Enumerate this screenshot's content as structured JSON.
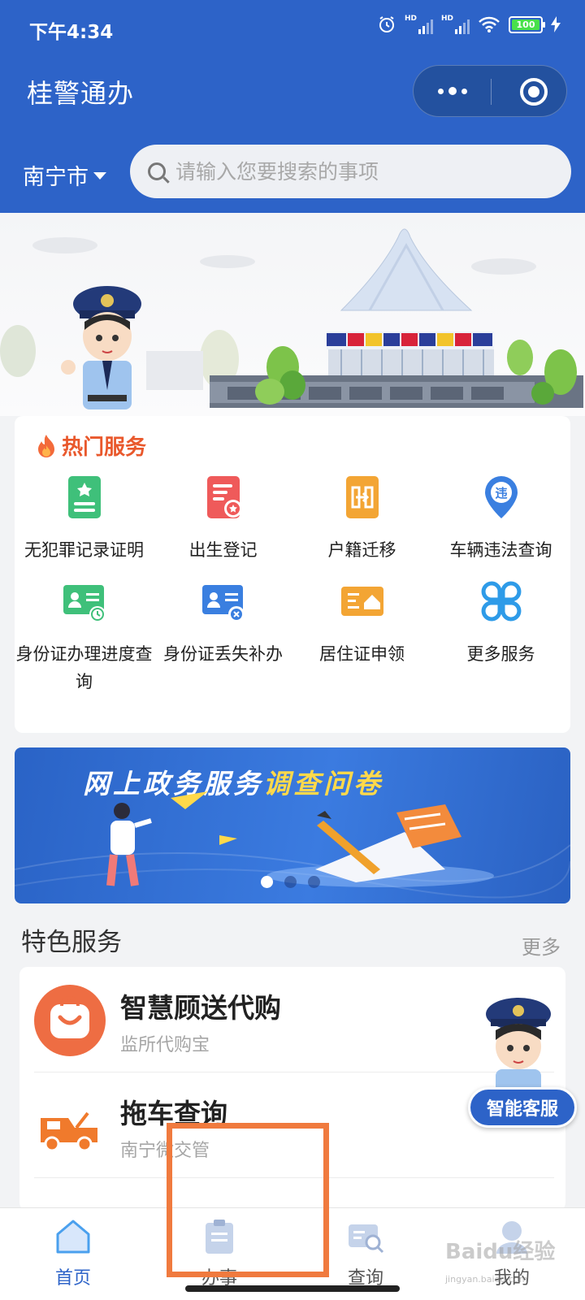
{
  "status_bar": {
    "time": "下午4:34",
    "hd1": "HD",
    "hd2": "HD",
    "battery": "100"
  },
  "header": {
    "title": "桂警通办",
    "city": "南宁市",
    "search_placeholder": "请输入您要搜索的事项"
  },
  "hot_services": {
    "title": "热门服务",
    "items": [
      {
        "label": "无犯罪记录证明",
        "icon": "certificate-icon",
        "color": "#3fc07a"
      },
      {
        "label": "出生登记",
        "icon": "birth-register-icon",
        "color": "#ef5a5a"
      },
      {
        "label": "户籍迁移",
        "icon": "household-transfer-icon",
        "color": "#f3a534"
      },
      {
        "label": "车辆违法查询",
        "icon": "vehicle-violation-icon",
        "color": "#3a7fe0"
      },
      {
        "label": "身份证办理进度查询",
        "icon": "id-progress-icon",
        "color": "#3fc07a"
      },
      {
        "label": "身份证丢失补办",
        "icon": "id-reissue-icon",
        "color": "#3a7fe0"
      },
      {
        "label": "居住证申领",
        "icon": "residence-permit-icon",
        "color": "#f3a534"
      },
      {
        "label": "更多服务",
        "icon": "more-services-icon",
        "color": "#2e9be8"
      }
    ]
  },
  "banner": {
    "title_part1": "网上政务服务",
    "title_part2": "调查问卷"
  },
  "featured": {
    "title": "特色服务",
    "more": "更多",
    "items": [
      {
        "name": "智慧顾送代购",
        "sub": "监所代购宝",
        "icon": "shopping-bag-icon"
      },
      {
        "name": "拖车查询",
        "sub": "南宁微交管",
        "icon": "tow-truck-icon"
      }
    ]
  },
  "kefu_label": "智能客服",
  "tabs": [
    {
      "label": "首页",
      "icon": "home-icon",
      "active": true
    },
    {
      "label": "办事",
      "icon": "clipboard-icon",
      "active": false
    },
    {
      "label": "查询",
      "icon": "query-icon",
      "active": false
    },
    {
      "label": "我的",
      "icon": "profile-icon",
      "active": false
    }
  ],
  "watermark": "Baidu经验",
  "watermark_url": "jingyan.baidu.com",
  "colors": {
    "primary": "#2d63c8",
    "hot": "#e9582c",
    "highlight": "#f07a3e"
  }
}
